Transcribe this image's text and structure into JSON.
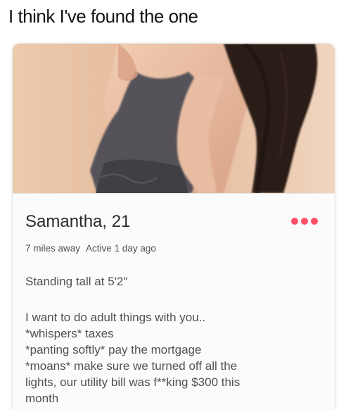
{
  "post": {
    "caption": "I think I've found the one"
  },
  "profile": {
    "name_age": "Samantha, 21",
    "distance": "7 miles away",
    "activity": "Active 1 day ago",
    "headline": "Standing tall at 5'2\"",
    "bio_lines": [
      "I want to do adult things with you..",
      "*whispers* taxes",
      "*panting softly* pay the mortgage",
      "*moans* make sure we turned off all the",
      "lights, our utility bill was f**king $300 this",
      "month"
    ]
  },
  "icons": {
    "more": "more-options-icon"
  },
  "colors": {
    "accent": "#fd5068",
    "text_primary": "#2b2b2b",
    "text_secondary": "#505050",
    "photo_background": "#e6bb9d"
  }
}
